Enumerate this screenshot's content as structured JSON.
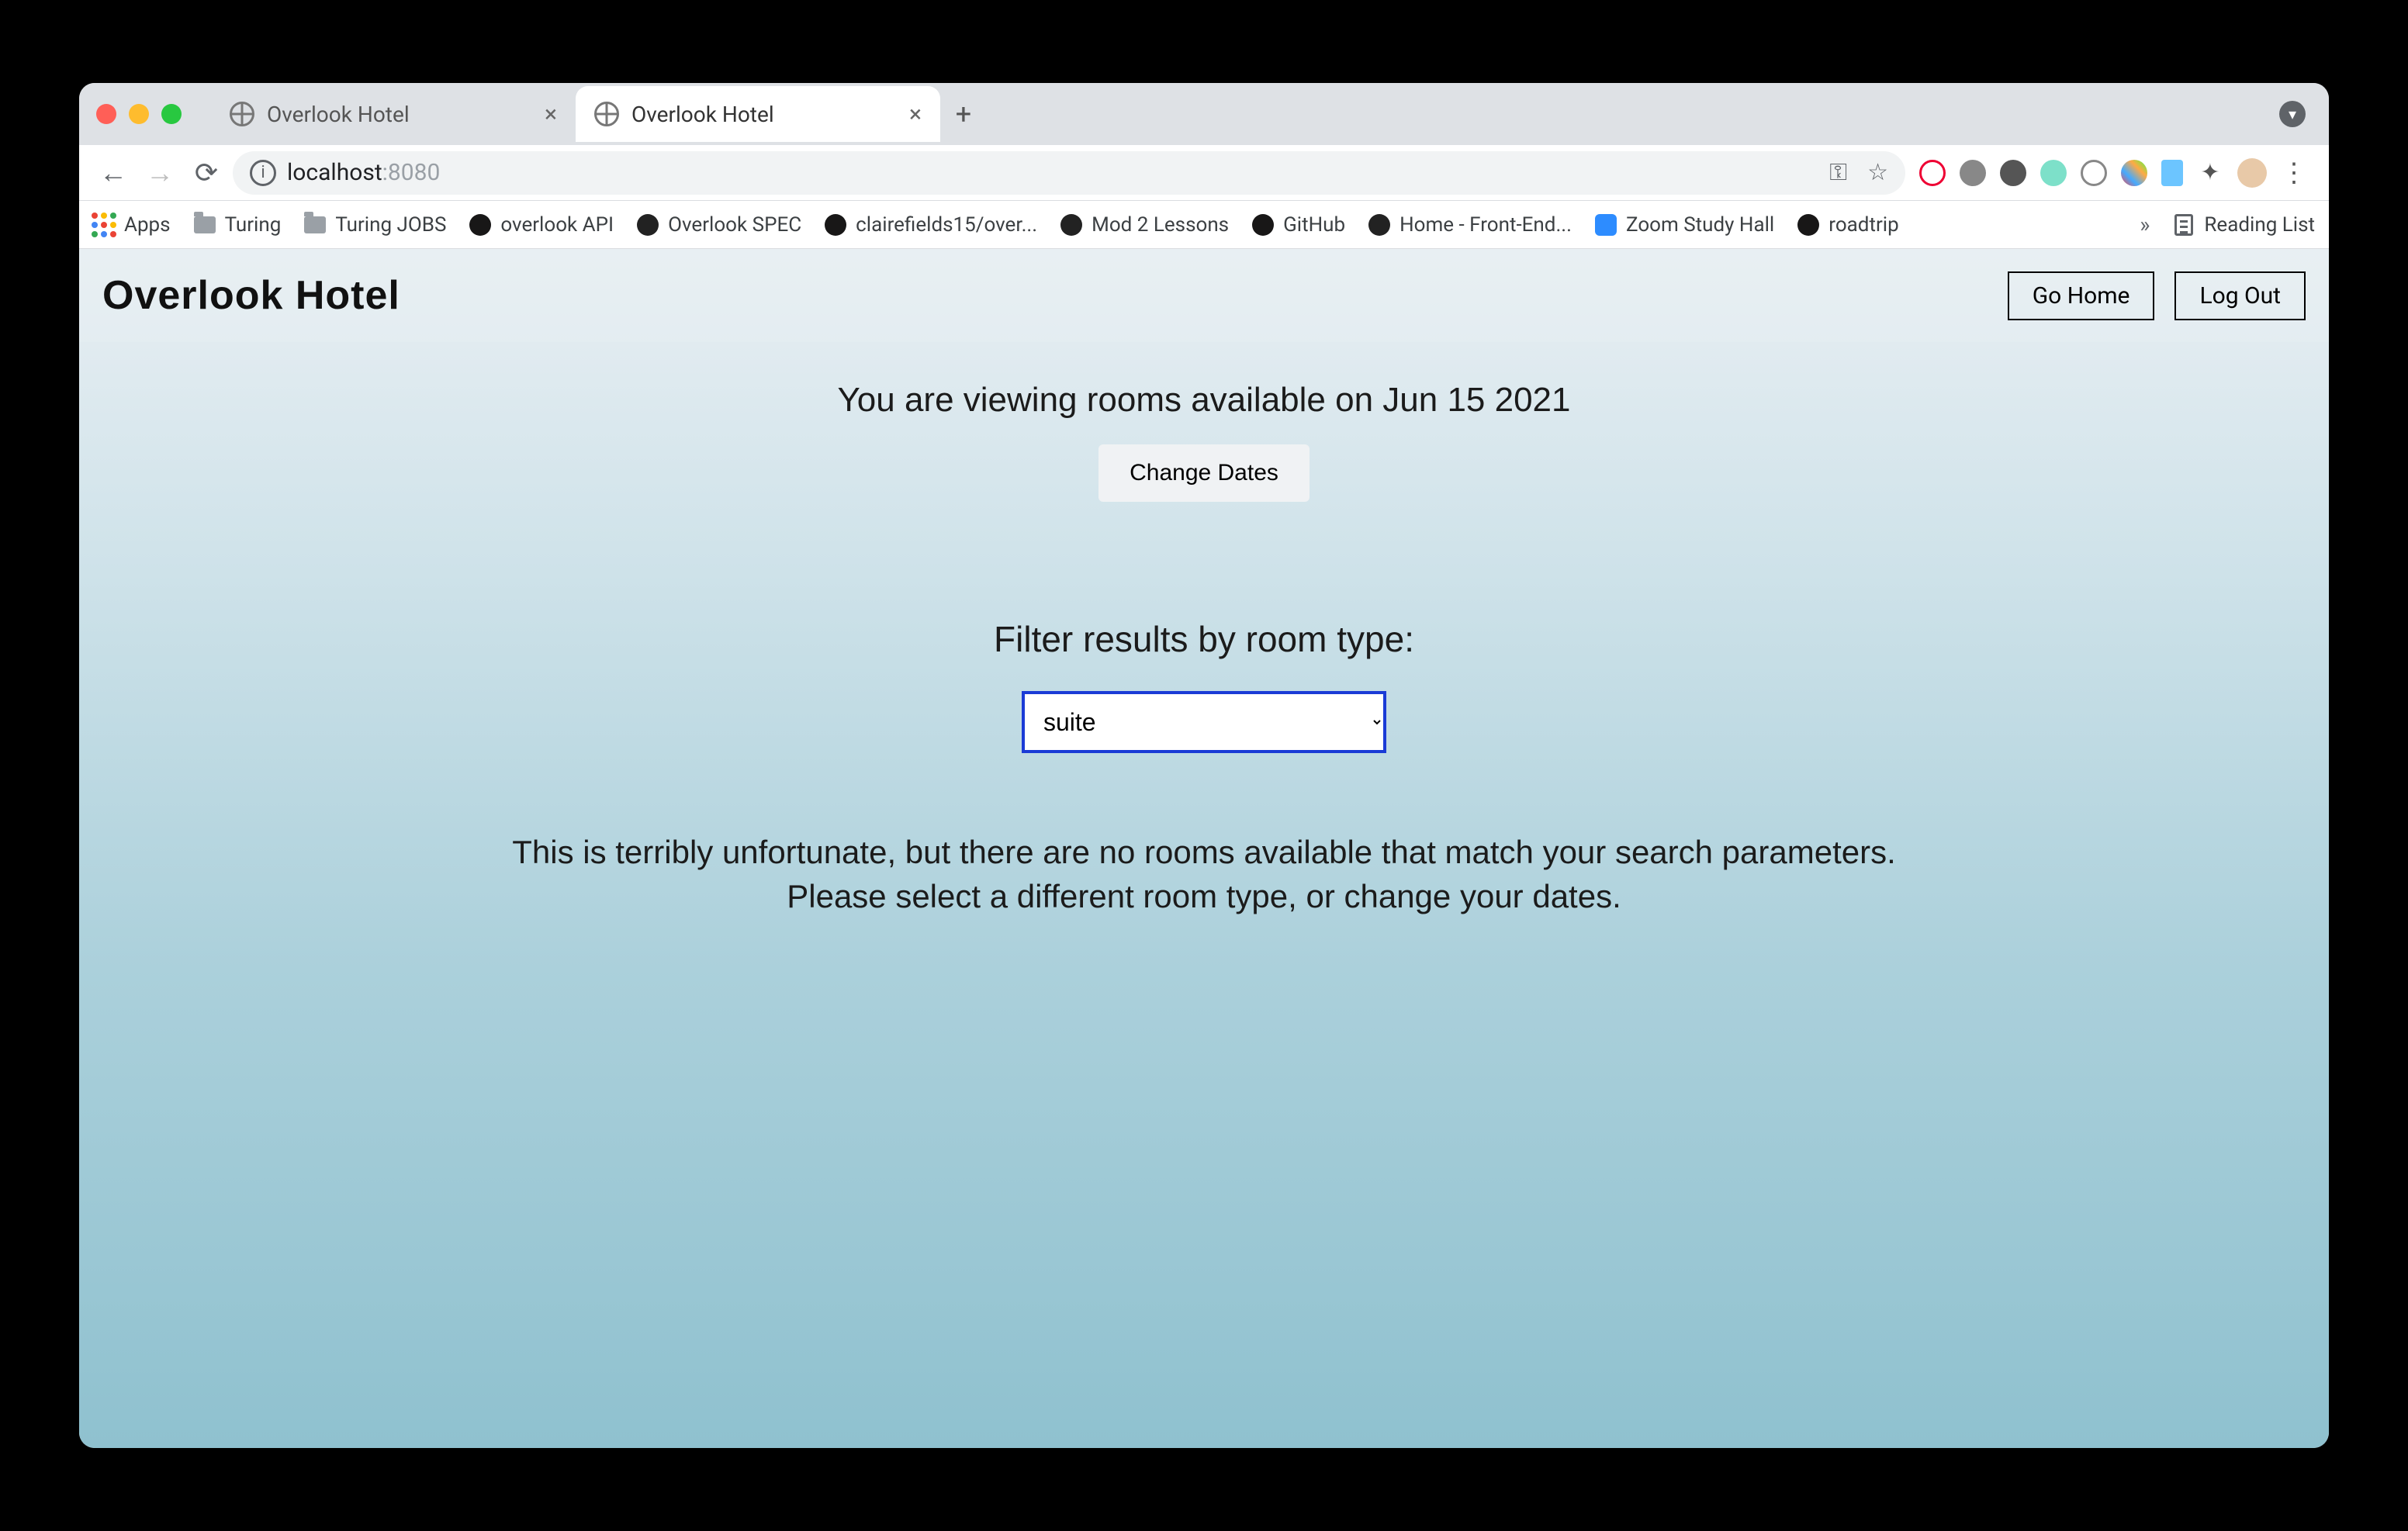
{
  "browser": {
    "tabs": [
      {
        "title": "Overlook Hotel",
        "active": false
      },
      {
        "title": "Overlook Hotel",
        "active": true
      }
    ],
    "url_host": "localhost",
    "url_port": ":8080",
    "bookmarks": {
      "apps": "Apps",
      "turing": "Turing",
      "turing_jobs": "Turing JOBS",
      "overlook_api": "overlook API",
      "overlook_spec": "Overlook SPEC",
      "clairefields": "clairefields15/over...",
      "mod2": "Mod 2 Lessons",
      "github": "GitHub",
      "home_fe": "Home - Front-End...",
      "zoom": "Zoom Study Hall",
      "roadtrip": "roadtrip",
      "reading_list": "Reading List"
    }
  },
  "app": {
    "brand": "Overlook Hotel",
    "go_home": "Go Home",
    "log_out": "Log Out",
    "viewing_heading": "You are viewing rooms available on Jun 15 2021",
    "change_dates": "Change Dates",
    "filter_heading": "Filter results by room type:",
    "room_type_selected": "suite",
    "no_results": "This is terribly unfortunate, but there are no rooms available that match your search parameters.\nPlease select a different room type, or change your dates."
  }
}
